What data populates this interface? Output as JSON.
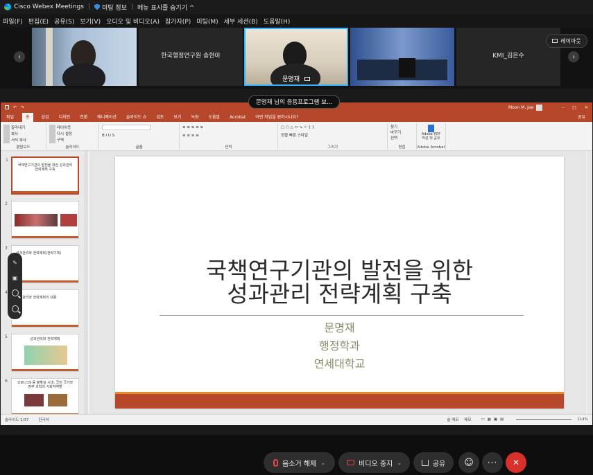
{
  "titlebar": {
    "app_name": "Cisco Webex Meetings",
    "meeting_info": "미팅 정보",
    "hide_menu": "메뉴 표시줄 숨기기 ^"
  },
  "menubar": {
    "items": [
      "파일(F)",
      "편집(E)",
      "공유(S)",
      "보기(V)",
      "오디오 및 비디오(A)",
      "참가자(P)",
      "미팅(M)",
      "세부 세션(B)",
      "도움말(H)"
    ]
  },
  "participants": {
    "tile2_name": "한국행정연구원 송현아",
    "tile3_name": "문명재",
    "tile5_name": "KMI_김은수",
    "layout_label": "레이아웃"
  },
  "share_banner": "문명재 님의 응용프로그램 보...",
  "ppt": {
    "title_right": "Moon M. Jae",
    "tabs": [
      "파일",
      "홈",
      "삽입",
      "디자인",
      "전환",
      "애니메이션",
      "슬라이드 쇼",
      "검토",
      "보기",
      "녹화",
      "도움말",
      "Acrobat",
      "어떤 작업을 원하시나요?"
    ],
    "share_label": "공유",
    "groups": {
      "clipboard": "클립보드",
      "slides": "슬라이드",
      "font": "글꼴",
      "paragraph": "단락",
      "drawing": "그리기",
      "editing": "편집",
      "acrobat": "Adobe Acrobat"
    },
    "ribbon_items": {
      "cut": "잘라내기",
      "copy": "복사",
      "format_paint": "서식 복사",
      "paste": "붙여넣기",
      "new_slide": "새 슬라이드",
      "layout": "레이아웃",
      "reset": "다시 설정",
      "section": "구역",
      "find": "찾기",
      "replace": "바꾸기",
      "select": "선택",
      "arrange": "정렬",
      "quick_style": "빠른 스타일",
      "adobe_pdf": "Adobe PDF 작성 및 공유"
    },
    "thumbnails": [
      {
        "num": "1",
        "text": "국책연구기관의 발전을 위한 성과관리 전략계획 구축"
      },
      {
        "num": "2",
        "text": ""
      },
      {
        "num": "3",
        "text": "성과관리와 전략계획(전략기획)"
      },
      {
        "num": "4",
        "text": "성과관리와 전략계획의 내용"
      },
      {
        "num": "5",
        "text": "성과관리와 전략계획"
      },
      {
        "num": "6",
        "text": "코로나19 등 불확실 시대, 국민 국가와 정부 과학의 사회적역할"
      }
    ],
    "slide": {
      "title_line1": "국책연구기관의 발전을 위한",
      "title_line2": "성과관리 전략계획 구축",
      "author": "문명재",
      "dept": "행정학과",
      "univ": "연세대학교"
    },
    "status": {
      "slide_pos": "슬라이드 1/37",
      "language": "한국어",
      "notes": "슬 메모",
      "memo": "메모",
      "zoom": "114%"
    }
  },
  "controls": {
    "mute": "음소거 해제",
    "video": "비디오 중지",
    "share": "공유"
  },
  "colors": {
    "ppt_accent": "#b7472a",
    "active_speaker": "#31b3ff",
    "end_call": "#d9302a"
  }
}
